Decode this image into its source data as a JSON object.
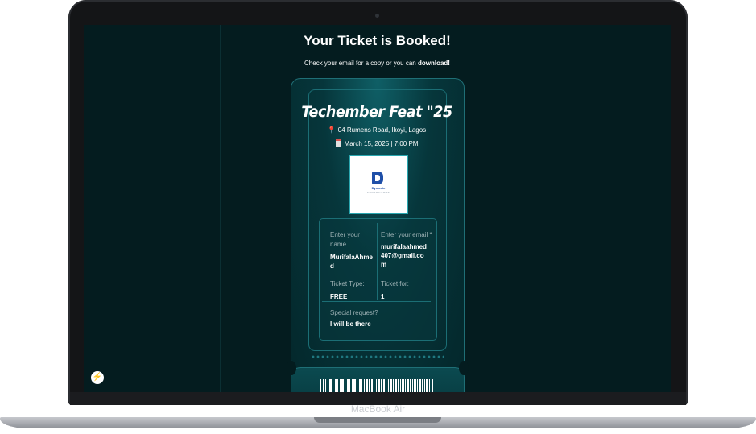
{
  "device": {
    "brand_label": "MacBook Air"
  },
  "page": {
    "title": "Your Ticket is Booked!",
    "subtitle_prefix": "Check your email for a copy or you can ",
    "download_link": "download!"
  },
  "ticket": {
    "event_name": "Techember Feat \"25",
    "location": "04 Rumens Road, Ikoyi, Lagos",
    "datetime": "March 15, 2025 | 7:00 PM",
    "logo": {
      "name": "Dynamic",
      "sub": "PRODUCTIONS"
    },
    "fields": {
      "name_label": "Enter your name",
      "name_value": "MurifalaAhmed",
      "email_label": "Enter your email *",
      "email_value": "murifalaahmed407@gmail.com",
      "type_label": "Ticket Type:",
      "type_value": "FREE",
      "for_label": "Ticket for:",
      "for_value": "1",
      "request_label": "Special request?",
      "request_value": "I will be there"
    }
  },
  "icons": [
    "location-pin-icon",
    "calendar-icon",
    "lightning-icon"
  ]
}
